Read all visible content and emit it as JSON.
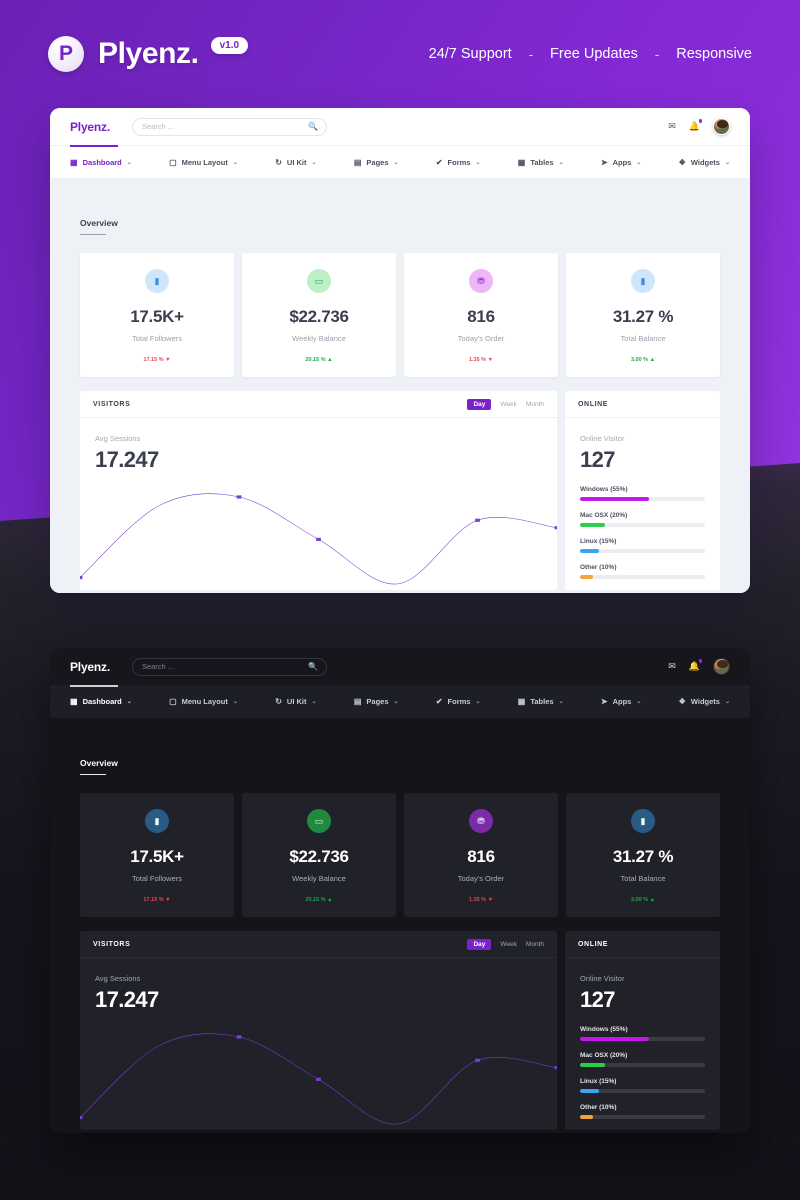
{
  "brand": {
    "logo_letter": "P",
    "name": "Plyenz.",
    "version": "v1.0",
    "features": [
      "24/7 Support",
      "Free Updates",
      "Responsive"
    ],
    "separator": "-"
  },
  "navbar": {
    "logo": "Plyenz.",
    "search_placeholder": "Search ...",
    "search_value": "",
    "search_icon": "search-icon",
    "icons": [
      {
        "name": "mail-icon",
        "glyph": "✉"
      },
      {
        "name": "bell-icon",
        "glyph": "☑"
      }
    ],
    "avatar_name": "user-avatar",
    "menu": [
      {
        "label": "Dashboard",
        "icon": "grid-icon",
        "glyph": "▦",
        "active": true
      },
      {
        "label": "Menu Layout",
        "icon": "monitor-icon",
        "glyph": "▢",
        "active": false
      },
      {
        "label": "UI Kit",
        "icon": "refresh-icon",
        "glyph": "↻",
        "active": false
      },
      {
        "label": "Pages",
        "icon": "book-icon",
        "glyph": "▤",
        "active": false
      },
      {
        "label": "Forms",
        "icon": "check-icon",
        "glyph": "✔",
        "active": false
      },
      {
        "label": "Tables",
        "icon": "table-icon",
        "glyph": "▦",
        "active": false
      },
      {
        "label": "Apps",
        "icon": "rocket-icon",
        "glyph": "➤",
        "active": false
      },
      {
        "label": "Widgets",
        "icon": "cube-icon",
        "glyph": "❖",
        "active": false
      }
    ],
    "caret": "⌄"
  },
  "section": {
    "overview_title": "Overview"
  },
  "cards": [
    {
      "value": "17.5K+",
      "label": "Total Followers",
      "trend": "17.15 %",
      "trend_dir": "▼",
      "trend_color": "#e8455c",
      "icon": "users-icon",
      "glyph": "▮",
      "icon_bg_light": "#d0e6fb",
      "icon_bg_dark": "#2a5b86",
      "icon_color": "#3c8ee0"
    },
    {
      "value": "$22.736",
      "label": "Weekly Balance",
      "trend": "20.15 %",
      "trend_dir": "▲",
      "trend_color": "#1ba94c",
      "icon": "money-icon",
      "glyph": "▭",
      "icon_bg_light": "#bdf0c9",
      "icon_bg_dark": "#1f8a3f",
      "icon_color": "#19a84a"
    },
    {
      "value": "816",
      "label": "Today's Order",
      "trend": "1.35 %",
      "trend_dir": "▼",
      "trend_color": "#e8455c",
      "icon": "cart-icon",
      "glyph": "⛃",
      "icon_bg_light": "#eeb6f7",
      "icon_bg_dark": "#7b2aa8",
      "icon_color": "#8f26d4"
    },
    {
      "value": "31.27 %",
      "label": "Total Balance",
      "trend": "3.00 %",
      "trend_dir": "▲",
      "trend_color": "#1ba94c",
      "icon": "users-icon",
      "glyph": "▮",
      "icon_bg_light": "#cfe5fb",
      "icon_bg_dark": "#2a5b86",
      "icon_color": "#3c8ee0"
    }
  ],
  "visitors": {
    "title": "VISITORS",
    "ranges": [
      "Day",
      "Week",
      "Month"
    ],
    "active_range": "Day",
    "kpi_label": "Avg Sessions",
    "kpi_value": "17.247"
  },
  "online": {
    "title": "ONLINE",
    "kpi_label": "Online Visitor",
    "kpi_value": "127",
    "items": [
      {
        "label": "Windows (55%)",
        "percent": 55,
        "color": "#c218e8"
      },
      {
        "label": "Mac OSX (20%)",
        "percent": 20,
        "color": "#2ad047"
      },
      {
        "label": "Linux (15%)",
        "percent": 15,
        "color": "#3aa4f0"
      },
      {
        "label": "Other (10%)",
        "percent": 10,
        "color": "#f0a43a"
      }
    ]
  },
  "chart_data": {
    "type": "line",
    "title": "Avg Sessions",
    "xlabel": "",
    "ylabel": "",
    "series": [
      {
        "name": "Sessions",
        "x": [
          0,
          1,
          2,
          3,
          4,
          5,
          6
        ],
        "values": [
          8,
          76,
          84,
          44,
          2,
          62,
          55
        ]
      }
    ],
    "ylim": [
      0,
      100
    ],
    "grid": false,
    "legend": "none",
    "line_color": "#7a3fd4",
    "markers": true
  },
  "colors": {
    "accent": "#7a22c9",
    "purple_bg": "#7f27cf",
    "dark_bg": "#141419",
    "light_bg": "#eef1f6",
    "up": "#1ba94c",
    "down": "#e8455c"
  }
}
